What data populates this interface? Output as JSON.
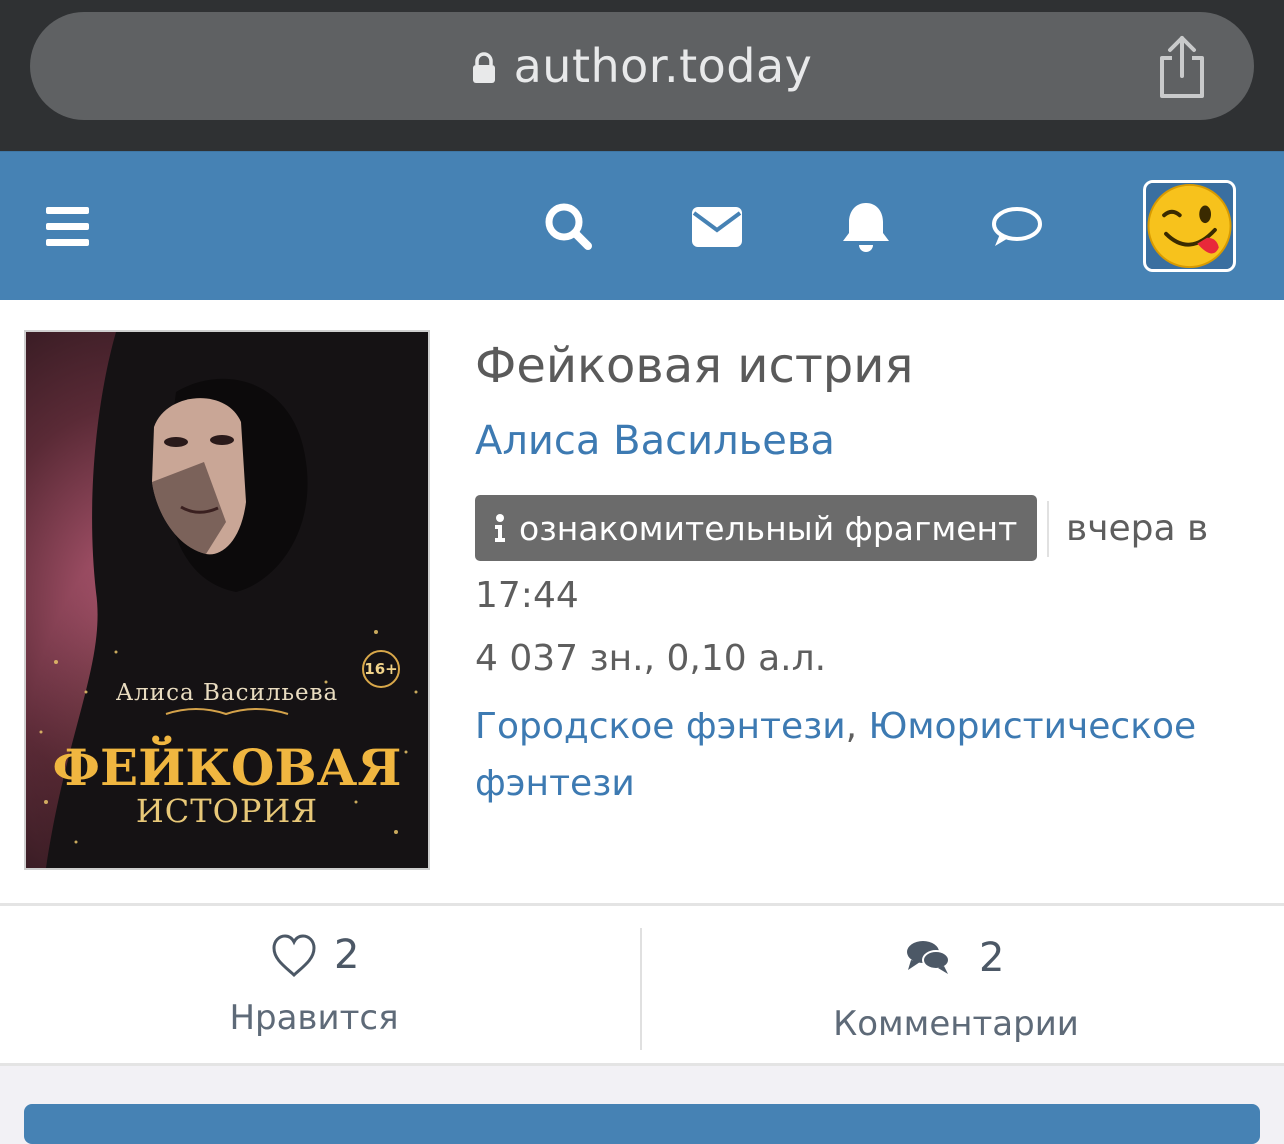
{
  "browser": {
    "domain": "author.today",
    "lock_icon": "lock-icon",
    "share_icon": "share-icon"
  },
  "nav": {
    "icons": [
      "menu-icon",
      "search-icon",
      "mail-icon",
      "bell-icon",
      "chat-icon"
    ],
    "avatar": "winking-face-emoji",
    "background_color": "#4682b4"
  },
  "book": {
    "cover": {
      "author": "Алиса Васильева",
      "title_line1": "ФЕЙКОВАЯ",
      "title_line2": "ИСТОРИЯ",
      "age_rating": "16+"
    },
    "title": "Фейковая истрия",
    "author": "Алиса Васильева",
    "badge_label": "ознакомительный фрагмент",
    "date_part1": "вчера в",
    "date_part2": "17:44",
    "stats": "4 037 зн., 0,10 а.л.",
    "genres": [
      "Городское фэнтези",
      "Юмористическое фэнтези"
    ],
    "genre_separator": ", "
  },
  "actions": {
    "likes_count": "2",
    "likes_label": "Нравится",
    "comments_count": "2",
    "comments_label": "Комментарии"
  },
  "colors": {
    "link": "#3d7ab2",
    "badge": "#6b6b6b",
    "cover_title": "#f0b640"
  }
}
